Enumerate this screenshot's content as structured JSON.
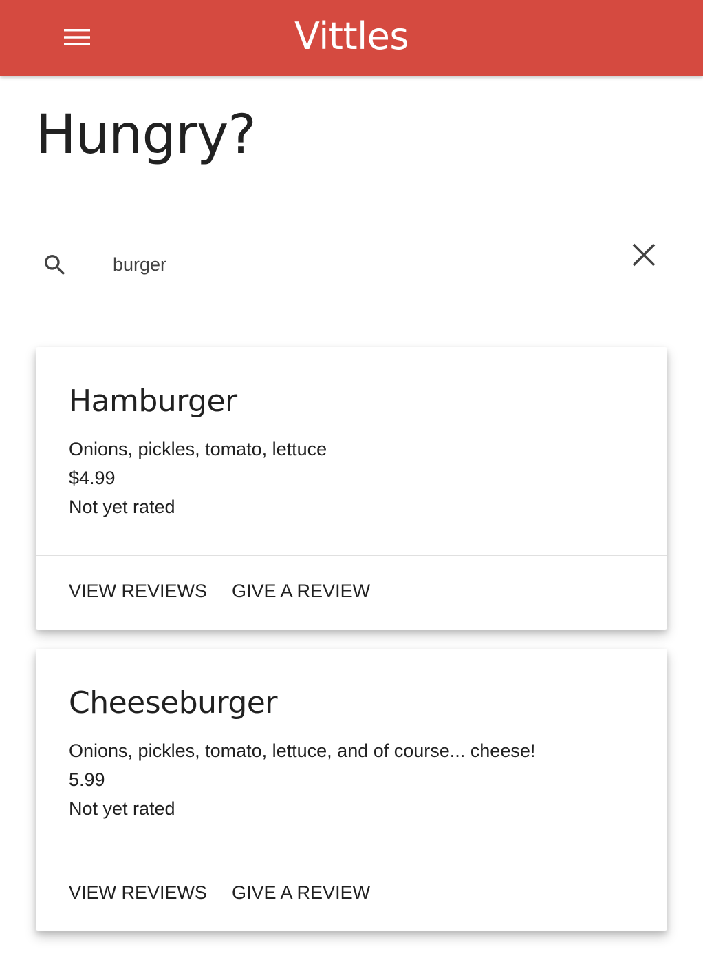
{
  "app_bar": {
    "title": "Vittles",
    "menu_icon": "hamburger-menu-icon",
    "background_color": "#d54a40"
  },
  "page": {
    "heading": "Hungry?"
  },
  "search": {
    "icon": "search-icon",
    "value": "burger",
    "clear_icon": "close-icon"
  },
  "menu_items": [
    {
      "name": "Hamburger",
      "description": "Onions, pickles, tomato, lettuce",
      "price": "$4.99",
      "rating": "Not yet rated",
      "actions": {
        "view_reviews": "VIEW REVIEWS",
        "give_review": "GIVE A REVIEW"
      }
    },
    {
      "name": "Cheeseburger",
      "description": "Onions, pickles, tomato, lettuce, and of course... cheese!",
      "price": "5.99",
      "rating": "Not yet rated",
      "actions": {
        "view_reviews": "VIEW REVIEWS",
        "give_review": "GIVE A REVIEW"
      }
    }
  ]
}
